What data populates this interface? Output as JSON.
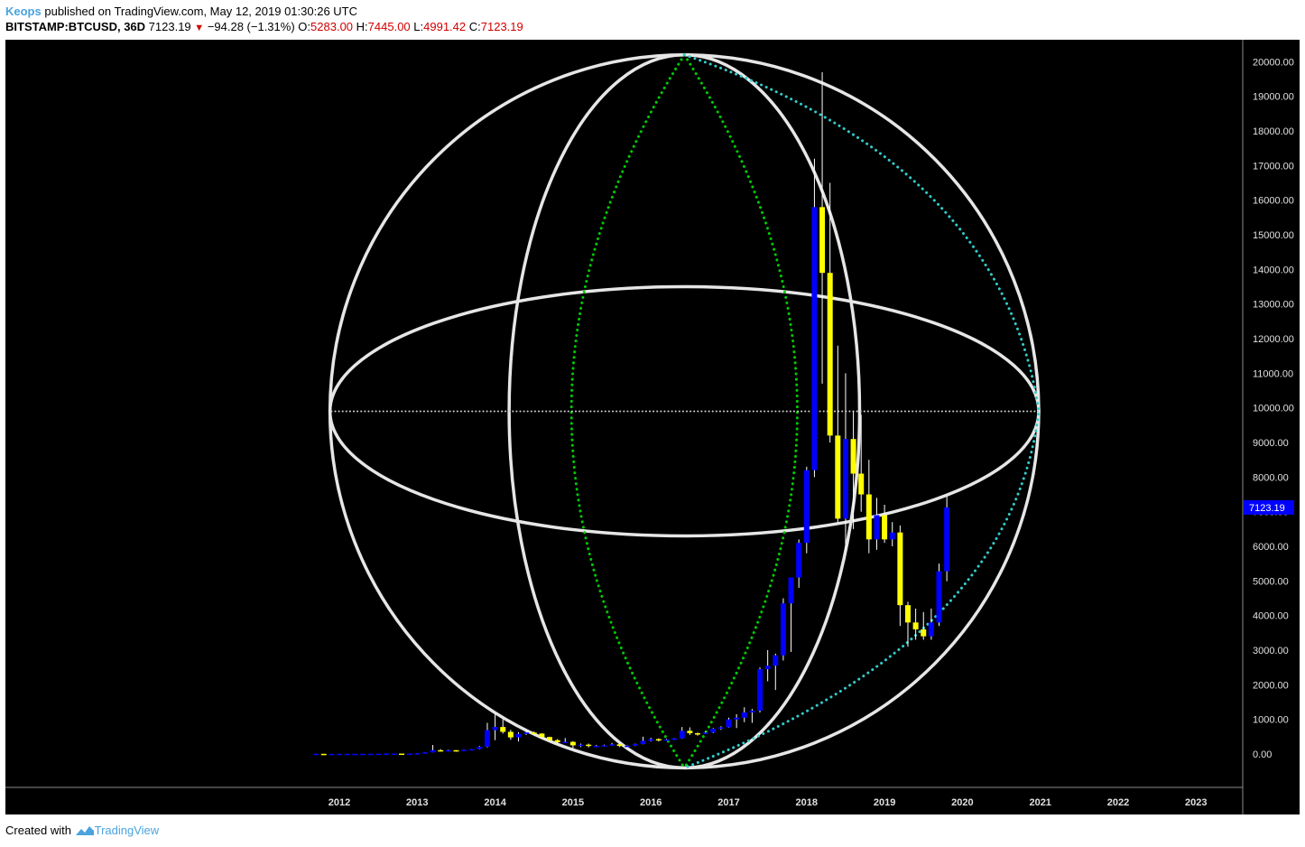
{
  "header": {
    "author": "Keops",
    "published_text": "published on TradingView.com, May 12, 2019 01:30:26 UTC",
    "symbol": "BITSTAMP:BTCUSD, 36D",
    "last_price": "7123.19",
    "change": "−94.28 (−1.31%)",
    "open_label": "O:",
    "open_value": "5283.00",
    "high_label": "H:",
    "high_value": "7445.00",
    "low_label": "L:",
    "low_value": "4991.42",
    "close_label": "C:",
    "close_value": "7123.19"
  },
  "footer": {
    "created_with": "Created with",
    "brand": "TradingView"
  },
  "colors": {
    "background": "#000000",
    "up_candle": "#0000ff",
    "down_candle": "#ffff00",
    "wick": "#ffffff",
    "sphere_lines": "#e6e6e6",
    "green_dots": "#00cc00",
    "cyan_dots": "#33cccc",
    "price_badge": "#0000ff"
  },
  "chart_data": {
    "type": "candlestick",
    "symbol": "BITSTAMP:BTCUSD",
    "interval": "36D",
    "title": "",
    "xlabel": "",
    "ylabel": "",
    "x_ticks": [
      "2012",
      "2013",
      "2014",
      "2015",
      "2016",
      "2017",
      "2018",
      "2019",
      "2020",
      "2021",
      "2022",
      "2023"
    ],
    "y_ticks": [
      "0.00",
      "1000.00",
      "2000.00",
      "3000.00",
      "4000.00",
      "5000.00",
      "6000.00",
      "7000.00",
      "8000.00",
      "9000.00",
      "10000.00",
      "11000.00",
      "12000.00",
      "13000.00",
      "14000.00",
      "15000.00",
      "16000.00",
      "17000.00",
      "18000.00",
      "19000.00",
      "20000.00"
    ],
    "ylim": [
      -400,
      20300
    ],
    "xlim": [
      2011.0,
      2023.5
    ],
    "last_price_label": "7123.19",
    "last_price": 7123.19,
    "candles": [
      {
        "t": 2011.7,
        "o": 5,
        "h": 10,
        "l": 3,
        "c": 5
      },
      {
        "t": 2011.8,
        "o": 5,
        "h": 7,
        "l": 2,
        "c": 3
      },
      {
        "t": 2011.9,
        "o": 3,
        "h": 4,
        "l": 2,
        "c": 3
      },
      {
        "t": 2012.0,
        "o": 3,
        "h": 6,
        "l": 3,
        "c": 5
      },
      {
        "t": 2012.1,
        "o": 5,
        "h": 6,
        "l": 4,
        "c": 5
      },
      {
        "t": 2012.2,
        "o": 5,
        "h": 5,
        "l": 4,
        "c": 5
      },
      {
        "t": 2012.3,
        "o": 5,
        "h": 6,
        "l": 4,
        "c": 5
      },
      {
        "t": 2012.4,
        "o": 5,
        "h": 7,
        "l": 5,
        "c": 7
      },
      {
        "t": 2012.5,
        "o": 7,
        "h": 9,
        "l": 6,
        "c": 9
      },
      {
        "t": 2012.6,
        "o": 9,
        "h": 15,
        "l": 7,
        "c": 12
      },
      {
        "t": 2012.7,
        "o": 12,
        "h": 13,
        "l": 10,
        "c": 12
      },
      {
        "t": 2012.8,
        "o": 12,
        "h": 13,
        "l": 10,
        "c": 11
      },
      {
        "t": 2012.9,
        "o": 11,
        "h": 14,
        "l": 11,
        "c": 13
      },
      {
        "t": 2013.0,
        "o": 13,
        "h": 22,
        "l": 13,
        "c": 20
      },
      {
        "t": 2013.1,
        "o": 20,
        "h": 48,
        "l": 20,
        "c": 46
      },
      {
        "t": 2013.2,
        "o": 46,
        "h": 260,
        "l": 45,
        "c": 110
      },
      {
        "t": 2013.3,
        "o": 110,
        "h": 140,
        "l": 70,
        "c": 95
      },
      {
        "t": 2013.4,
        "o": 95,
        "h": 125,
        "l": 70,
        "c": 110
      },
      {
        "t": 2013.5,
        "o": 110,
        "h": 110,
        "l": 65,
        "c": 95
      },
      {
        "t": 2013.6,
        "o": 95,
        "h": 125,
        "l": 90,
        "c": 120
      },
      {
        "t": 2013.7,
        "o": 120,
        "h": 145,
        "l": 110,
        "c": 140
      },
      {
        "t": 2013.8,
        "o": 140,
        "h": 230,
        "l": 130,
        "c": 210
      },
      {
        "t": 2013.9,
        "o": 210,
        "h": 900,
        "l": 190,
        "c": 690
      },
      {
        "t": 2014.0,
        "o": 690,
        "h": 1160,
        "l": 400,
        "c": 780
      },
      {
        "t": 2014.1,
        "o": 780,
        "h": 1000,
        "l": 590,
        "c": 640
      },
      {
        "t": 2014.2,
        "o": 640,
        "h": 700,
        "l": 410,
        "c": 480
      },
      {
        "t": 2014.3,
        "o": 480,
        "h": 630,
        "l": 360,
        "c": 580
      },
      {
        "t": 2014.4,
        "o": 580,
        "h": 680,
        "l": 550,
        "c": 620
      },
      {
        "t": 2014.5,
        "o": 620,
        "h": 650,
        "l": 540,
        "c": 590
      },
      {
        "t": 2014.6,
        "o": 590,
        "h": 600,
        "l": 470,
        "c": 490
      },
      {
        "t": 2014.7,
        "o": 490,
        "h": 500,
        "l": 370,
        "c": 400
      },
      {
        "t": 2014.8,
        "o": 400,
        "h": 430,
        "l": 280,
        "c": 340
      },
      {
        "t": 2014.9,
        "o": 340,
        "h": 460,
        "l": 320,
        "c": 350
      },
      {
        "t": 2015.0,
        "o": 350,
        "h": 370,
        "l": 160,
        "c": 250
      },
      {
        "t": 2015.1,
        "o": 250,
        "h": 300,
        "l": 200,
        "c": 270
      },
      {
        "t": 2015.2,
        "o": 270,
        "h": 300,
        "l": 190,
        "c": 230
      },
      {
        "t": 2015.3,
        "o": 230,
        "h": 260,
        "l": 200,
        "c": 235
      },
      {
        "t": 2015.4,
        "o": 235,
        "h": 270,
        "l": 220,
        "c": 250
      },
      {
        "t": 2015.5,
        "o": 250,
        "h": 320,
        "l": 240,
        "c": 280
      },
      {
        "t": 2015.6,
        "o": 280,
        "h": 300,
        "l": 200,
        "c": 230
      },
      {
        "t": 2015.7,
        "o": 230,
        "h": 250,
        "l": 210,
        "c": 240
      },
      {
        "t": 2015.8,
        "o": 240,
        "h": 300,
        "l": 230,
        "c": 290
      },
      {
        "t": 2015.9,
        "o": 290,
        "h": 500,
        "l": 280,
        "c": 380
      },
      {
        "t": 2016.0,
        "o": 380,
        "h": 470,
        "l": 360,
        "c": 430
      },
      {
        "t": 2016.1,
        "o": 430,
        "h": 450,
        "l": 360,
        "c": 400
      },
      {
        "t": 2016.2,
        "o": 400,
        "h": 440,
        "l": 390,
        "c": 420
      },
      {
        "t": 2016.3,
        "o": 420,
        "h": 460,
        "l": 410,
        "c": 450
      },
      {
        "t": 2016.4,
        "o": 450,
        "h": 780,
        "l": 440,
        "c": 670
      },
      {
        "t": 2016.5,
        "o": 670,
        "h": 770,
        "l": 550,
        "c": 600
      },
      {
        "t": 2016.6,
        "o": 600,
        "h": 620,
        "l": 530,
        "c": 580
      },
      {
        "t": 2016.7,
        "o": 580,
        "h": 650,
        "l": 580,
        "c": 620
      },
      {
        "t": 2016.8,
        "o": 620,
        "h": 750,
        "l": 600,
        "c": 730
      },
      {
        "t": 2016.9,
        "o": 730,
        "h": 800,
        "l": 700,
        "c": 770
      },
      {
        "t": 2017.0,
        "o": 770,
        "h": 1050,
        "l": 760,
        "c": 1000
      },
      {
        "t": 2017.1,
        "o": 1000,
        "h": 1150,
        "l": 750,
        "c": 1050
      },
      {
        "t": 2017.2,
        "o": 1050,
        "h": 1350,
        "l": 920,
        "c": 1200
      },
      {
        "t": 2017.3,
        "o": 1200,
        "h": 1300,
        "l": 900,
        "c": 1250
      },
      {
        "t": 2017.4,
        "o": 1250,
        "h": 2500,
        "l": 1200,
        "c": 2450
      },
      {
        "t": 2017.5,
        "o": 2450,
        "h": 3000,
        "l": 2100,
        "c": 2550
      },
      {
        "t": 2017.6,
        "o": 2550,
        "h": 2900,
        "l": 1850,
        "c": 2850
      },
      {
        "t": 2017.7,
        "o": 2850,
        "h": 4500,
        "l": 2700,
        "c": 4350
      },
      {
        "t": 2017.8,
        "o": 4350,
        "h": 5000,
        "l": 2950,
        "c": 5100
      },
      {
        "t": 2017.9,
        "o": 5100,
        "h": 6200,
        "l": 4800,
        "c": 6100
      },
      {
        "t": 2018.0,
        "o": 6100,
        "h": 8300,
        "l": 5800,
        "c": 8200
      },
      {
        "t": 2018.1,
        "o": 8200,
        "h": 17200,
        "l": 8000,
        "c": 15800
      },
      {
        "t": 2018.2,
        "o": 15800,
        "h": 19700,
        "l": 10700,
        "c": 13900
      },
      {
        "t": 2018.3,
        "o": 13900,
        "h": 16500,
        "l": 9000,
        "c": 9200
      },
      {
        "t": 2018.4,
        "o": 9200,
        "h": 11800,
        "l": 6700,
        "c": 6800
      },
      {
        "t": 2018.5,
        "o": 6800,
        "h": 11000,
        "l": 5900,
        "c": 9100
      },
      {
        "t": 2018.6,
        "o": 9100,
        "h": 9900,
        "l": 6500,
        "c": 8100
      },
      {
        "t": 2018.7,
        "o": 8100,
        "h": 9800,
        "l": 7000,
        "c": 7500
      },
      {
        "t": 2018.8,
        "o": 7500,
        "h": 8500,
        "l": 5800,
        "c": 6200
      },
      {
        "t": 2018.9,
        "o": 6200,
        "h": 7400,
        "l": 5900,
        "c": 6900
      },
      {
        "t": 2019.0,
        "o": 6900,
        "h": 7200,
        "l": 6100,
        "c": 6200
      },
      {
        "t": 2019.1,
        "o": 6200,
        "h": 6700,
        "l": 6000,
        "c": 6400
      },
      {
        "t": 2019.2,
        "o": 6400,
        "h": 6600,
        "l": 3700,
        "c": 4300
      },
      {
        "t": 2019.3,
        "o": 4300,
        "h": 4400,
        "l": 3100,
        "c": 3800
      },
      {
        "t": 2019.4,
        "o": 3800,
        "h": 4200,
        "l": 3300,
        "c": 3600
      },
      {
        "t": 2019.5,
        "o": 3600,
        "h": 4100,
        "l": 3300,
        "c": 3400
      },
      {
        "t": 2019.6,
        "o": 3400,
        "h": 4200,
        "l": 3300,
        "c": 3800
      },
      {
        "t": 2019.7,
        "o": 3800,
        "h": 5500,
        "l": 3700,
        "c": 5280
      },
      {
        "t": 2019.8,
        "o": 5280,
        "h": 7445,
        "l": 4991.42,
        "c": 7123.19
      }
    ],
    "overlays": {
      "outer_circle": {
        "cx": 2016.43,
        "cy": 9900,
        "rx": 4.55,
        "ry": 10300
      },
      "horizontal_ellipse": {
        "cx": 2016.43,
        "cy": 9900,
        "rx": 4.55,
        "ry": 3600
      },
      "vertical_ellipse": {
        "cx": 2016.43,
        "cy": 9900,
        "rx": 2.25,
        "ry": 10300
      },
      "green_lens": {
        "cx": 2016.43,
        "top": 20200,
        "bottom": -400,
        "half_width": 1.45
      },
      "cyan_arc": {
        "top": [
          2016.43,
          20200
        ],
        "right": [
          2020.98,
          9900
        ],
        "bottom": [
          2016.43,
          -400
        ]
      },
      "equator_dots": {
        "x1": 2011.9,
        "x2": 2020.98,
        "y": 9900
      }
    }
  }
}
